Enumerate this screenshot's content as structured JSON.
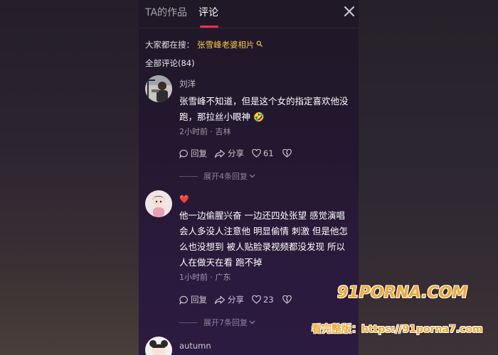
{
  "tabs": {
    "works": "TA的作品",
    "comments": "评论"
  },
  "search_hint": {
    "prefix": "大家都在搜：",
    "term": "张雪峰老婆相片"
  },
  "comment_count": "全部评论(84)",
  "comments": [
    {
      "username": "刘洋",
      "text": "张雪峰不知道，但是这个女的指定喜欢他没跑，那拉丝小眼神 🤣",
      "meta": "2小时前 · 吉林",
      "reply_label": "回复",
      "share_label": "分享",
      "likes": "61",
      "expand": "展开4条回复"
    },
    {
      "username": "❤️",
      "text": "他一边偷腥兴奋  一边还四处张望  感觉演唱会人多没人注意他  明显偷情  刺激  但是他怎么也没想到  被人贴脸录视频都没发现  所以  人在做天在看  跑不掉",
      "meta": "1小时前 · 广东",
      "reply_label": "回复",
      "share_label": "分享",
      "likes": "23",
      "expand": "展开7条回复"
    },
    {
      "username": "autumn"
    }
  ],
  "watermark": {
    "logo": "91PORNA.COM",
    "url": "看完整版：https://91porna7.com"
  },
  "colors": {
    "accent": "#fe2c55",
    "search_term": "#f5c44a",
    "watermark": "#f2a933"
  }
}
